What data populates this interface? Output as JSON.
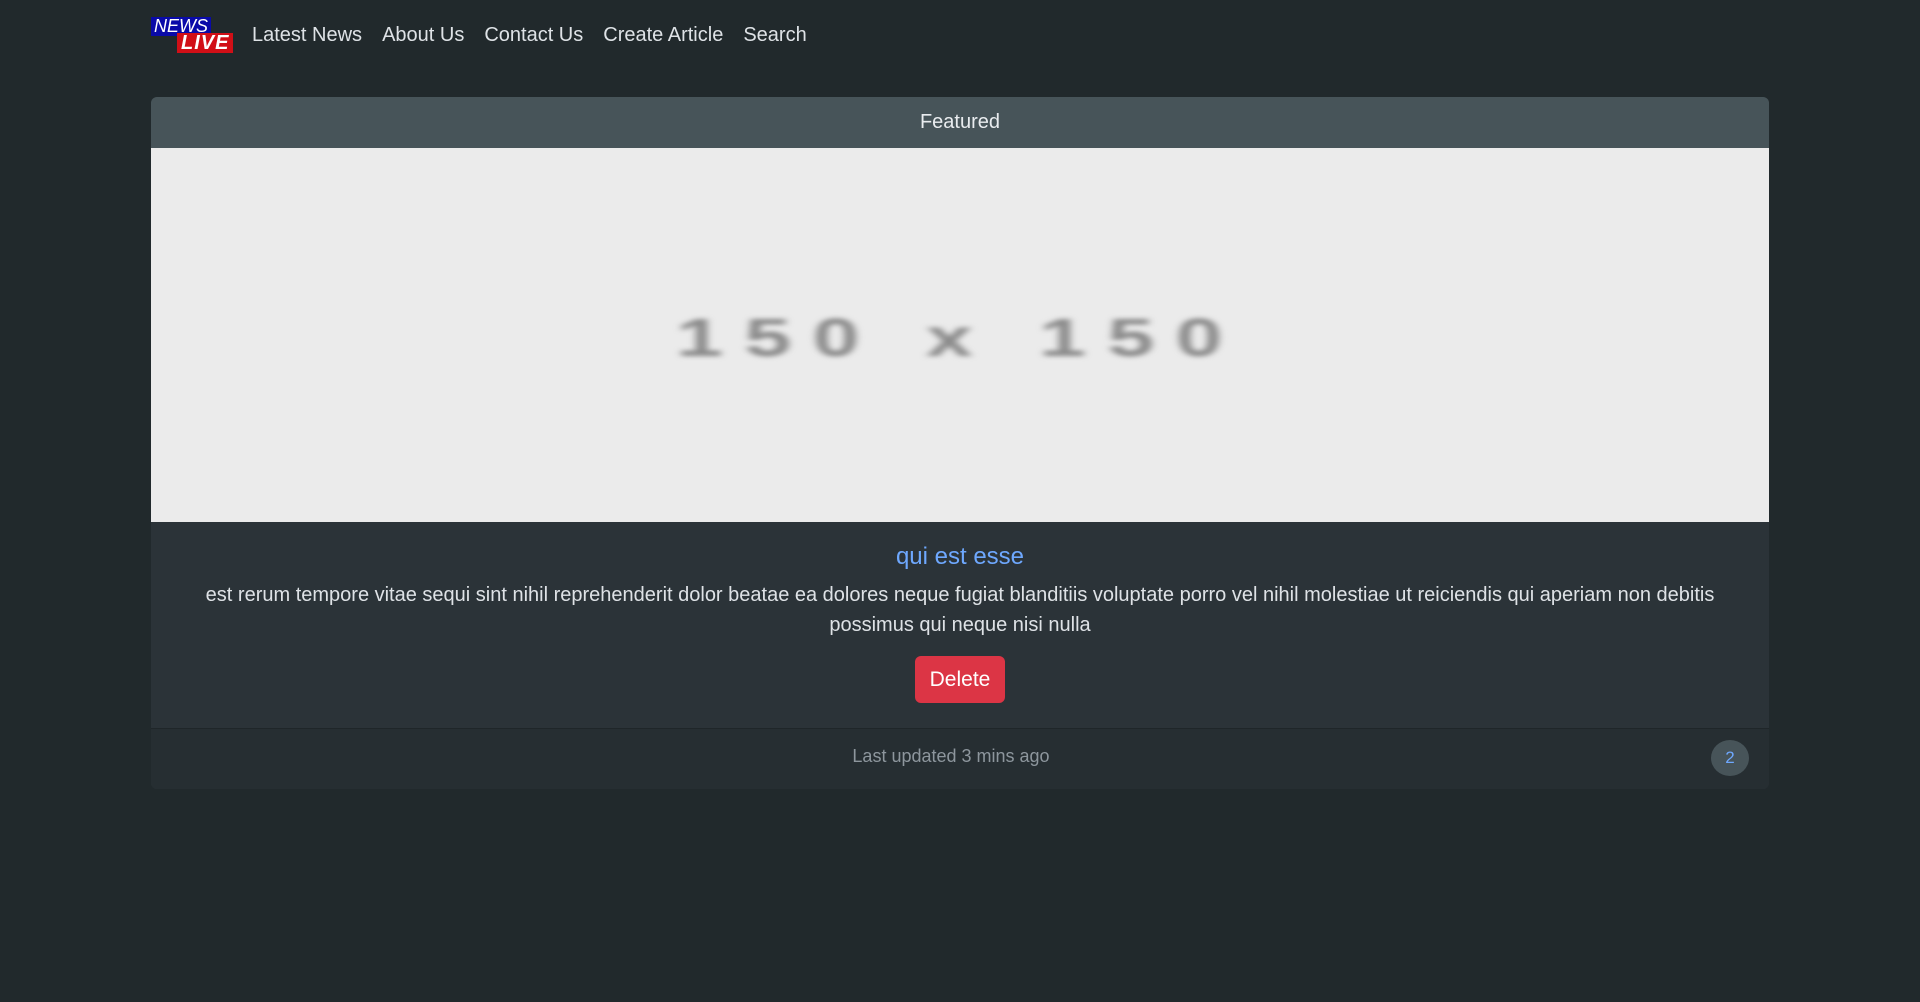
{
  "header": {
    "logo": {
      "news_text": "NEWS",
      "live_text": "LIVE"
    },
    "nav": [
      {
        "label": "Latest News"
      },
      {
        "label": "About Us"
      },
      {
        "label": "Contact Us"
      },
      {
        "label": "Create Article"
      },
      {
        "label": "Search"
      }
    ]
  },
  "card": {
    "header": "Featured",
    "image_placeholder": "150 x 150",
    "title": "qui est esse",
    "body": "est rerum tempore vitae sequi sint nihil reprehenderit dolor beatae ea dolores neque fugiat blanditiis voluptate porro vel nihil molestiae ut reiciendis qui aperiam non debitis possimus qui neque nisi nulla",
    "delete_label": "Delete",
    "footer_text": "Last updated 3 mins ago",
    "badge": "2"
  },
  "colors": {
    "background": "#21292c",
    "card_header": "#475459",
    "link": "#6ea8fe",
    "danger": "#dc3545"
  }
}
